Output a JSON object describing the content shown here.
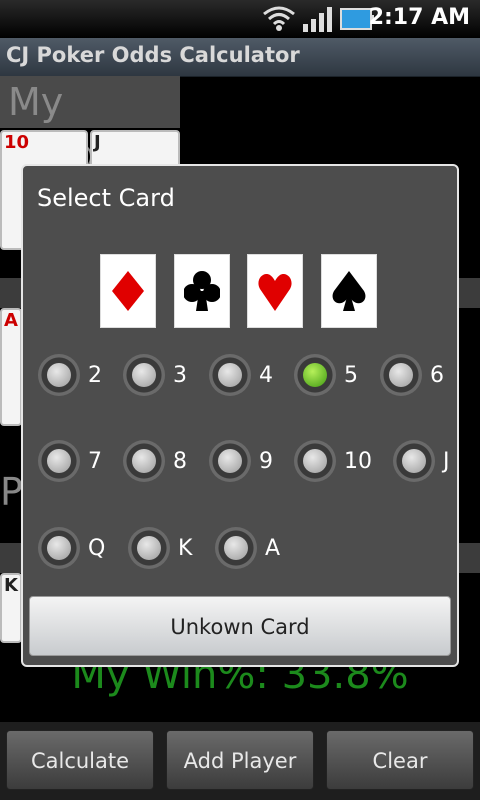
{
  "status_bar": {
    "time": "2:17 AM"
  },
  "app": {
    "title": "CJ Poker Odds Calculator"
  },
  "background": {
    "section_title": "My Cards",
    "cards": [
      "10",
      "J",
      "A",
      "K"
    ],
    "partial_letter": "P",
    "win_text": "My Win%: 33.8%",
    "buttons": {
      "calculate": "Calculate",
      "add_player": "Add Player",
      "clear": "Clear"
    }
  },
  "dialog": {
    "title": "Select Card",
    "suits": [
      {
        "name": "diamond",
        "color": "#e00000"
      },
      {
        "name": "club",
        "color": "#000000"
      },
      {
        "name": "heart",
        "color": "#e00000"
      },
      {
        "name": "spade",
        "color": "#000000"
      }
    ],
    "ranks": [
      "2",
      "3",
      "4",
      "5",
      "6",
      "7",
      "8",
      "9",
      "10",
      "J",
      "Q",
      "K",
      "A"
    ],
    "selected_rank": "5",
    "unknown_label": "Unkown Card"
  },
  "colors": {
    "accent_green": "#4caf1a",
    "win_green": "#1c8a1c"
  }
}
